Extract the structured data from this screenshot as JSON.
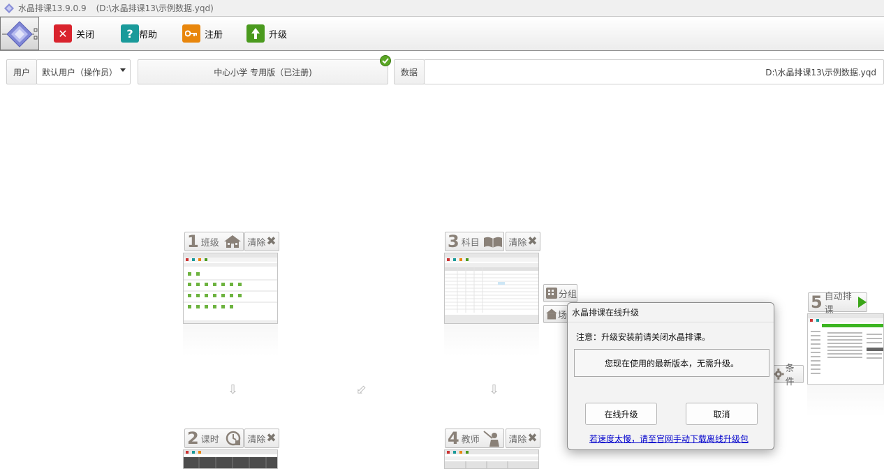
{
  "window": {
    "title": "水晶排课13.9.0.9",
    "path": "(D:\\水晶排课13\\示例数据.yqd)"
  },
  "toolbar": {
    "close_label": "关闭",
    "help_label": "帮助",
    "register_label": "注册",
    "upgrade_label": "升级"
  },
  "info": {
    "user_label": "用户",
    "user_value": "默认用户（操作员）",
    "license": "中心小学 专用版（已注册)",
    "data_label": "数据",
    "data_value": "D:\\水晶排课13\\示例数据.yqd"
  },
  "flow": {
    "clear_label": "清除",
    "steps": [
      {
        "num": "1",
        "label": "班级"
      },
      {
        "num": "3",
        "label": "科目"
      },
      {
        "num": "5",
        "label": "自动排课"
      },
      {
        "num": "2",
        "label": "课时"
      },
      {
        "num": "4",
        "label": "教师"
      }
    ],
    "group_label": "分组",
    "venue_label": "场",
    "condition_label": "条件"
  },
  "dialog": {
    "title": "水晶排课在线升级",
    "note": "注意：升级安装前请关闭水晶排课。",
    "message": "您现在使用的最新版本，无需升级。",
    "online_upgrade_label": "在线升级",
    "cancel_label": "取消",
    "link_text": "若速度太慢，请至官网手动下载离线升级包"
  },
  "colors": {
    "close_red": "#d9232d",
    "help_teal": "#1a9a9a",
    "register_orange": "#e8860c",
    "upgrade_green": "#4a9a1e",
    "dialog_bg": "#f3f3f3",
    "link_blue": "#0000cc"
  }
}
